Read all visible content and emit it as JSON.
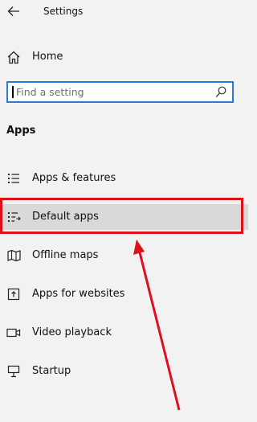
{
  "titlebar": {
    "title": "Settings",
    "back_icon": "back-arrow-icon"
  },
  "home": {
    "label": "Home",
    "icon": "home-icon"
  },
  "search": {
    "placeholder": "Find a setting",
    "value": "",
    "icon": "search-icon"
  },
  "section": {
    "heading": "Apps"
  },
  "nav_items": [
    {
      "label": "Apps & features",
      "icon": "apps-features-icon"
    },
    {
      "label": "Default apps",
      "icon": "default-apps-icon",
      "selected": true
    },
    {
      "label": "Offline maps",
      "icon": "offline-maps-icon"
    },
    {
      "label": "Apps for websites",
      "icon": "apps-for-websites-icon"
    },
    {
      "label": "Video playback",
      "icon": "video-playback-icon"
    },
    {
      "label": "Startup",
      "icon": "startup-icon"
    }
  ],
  "colors": {
    "background": "#f2f2f2",
    "selected_background": "#d9d9d9",
    "search_border": "#2b7bd5",
    "annotation_red": "#e0101a"
  }
}
